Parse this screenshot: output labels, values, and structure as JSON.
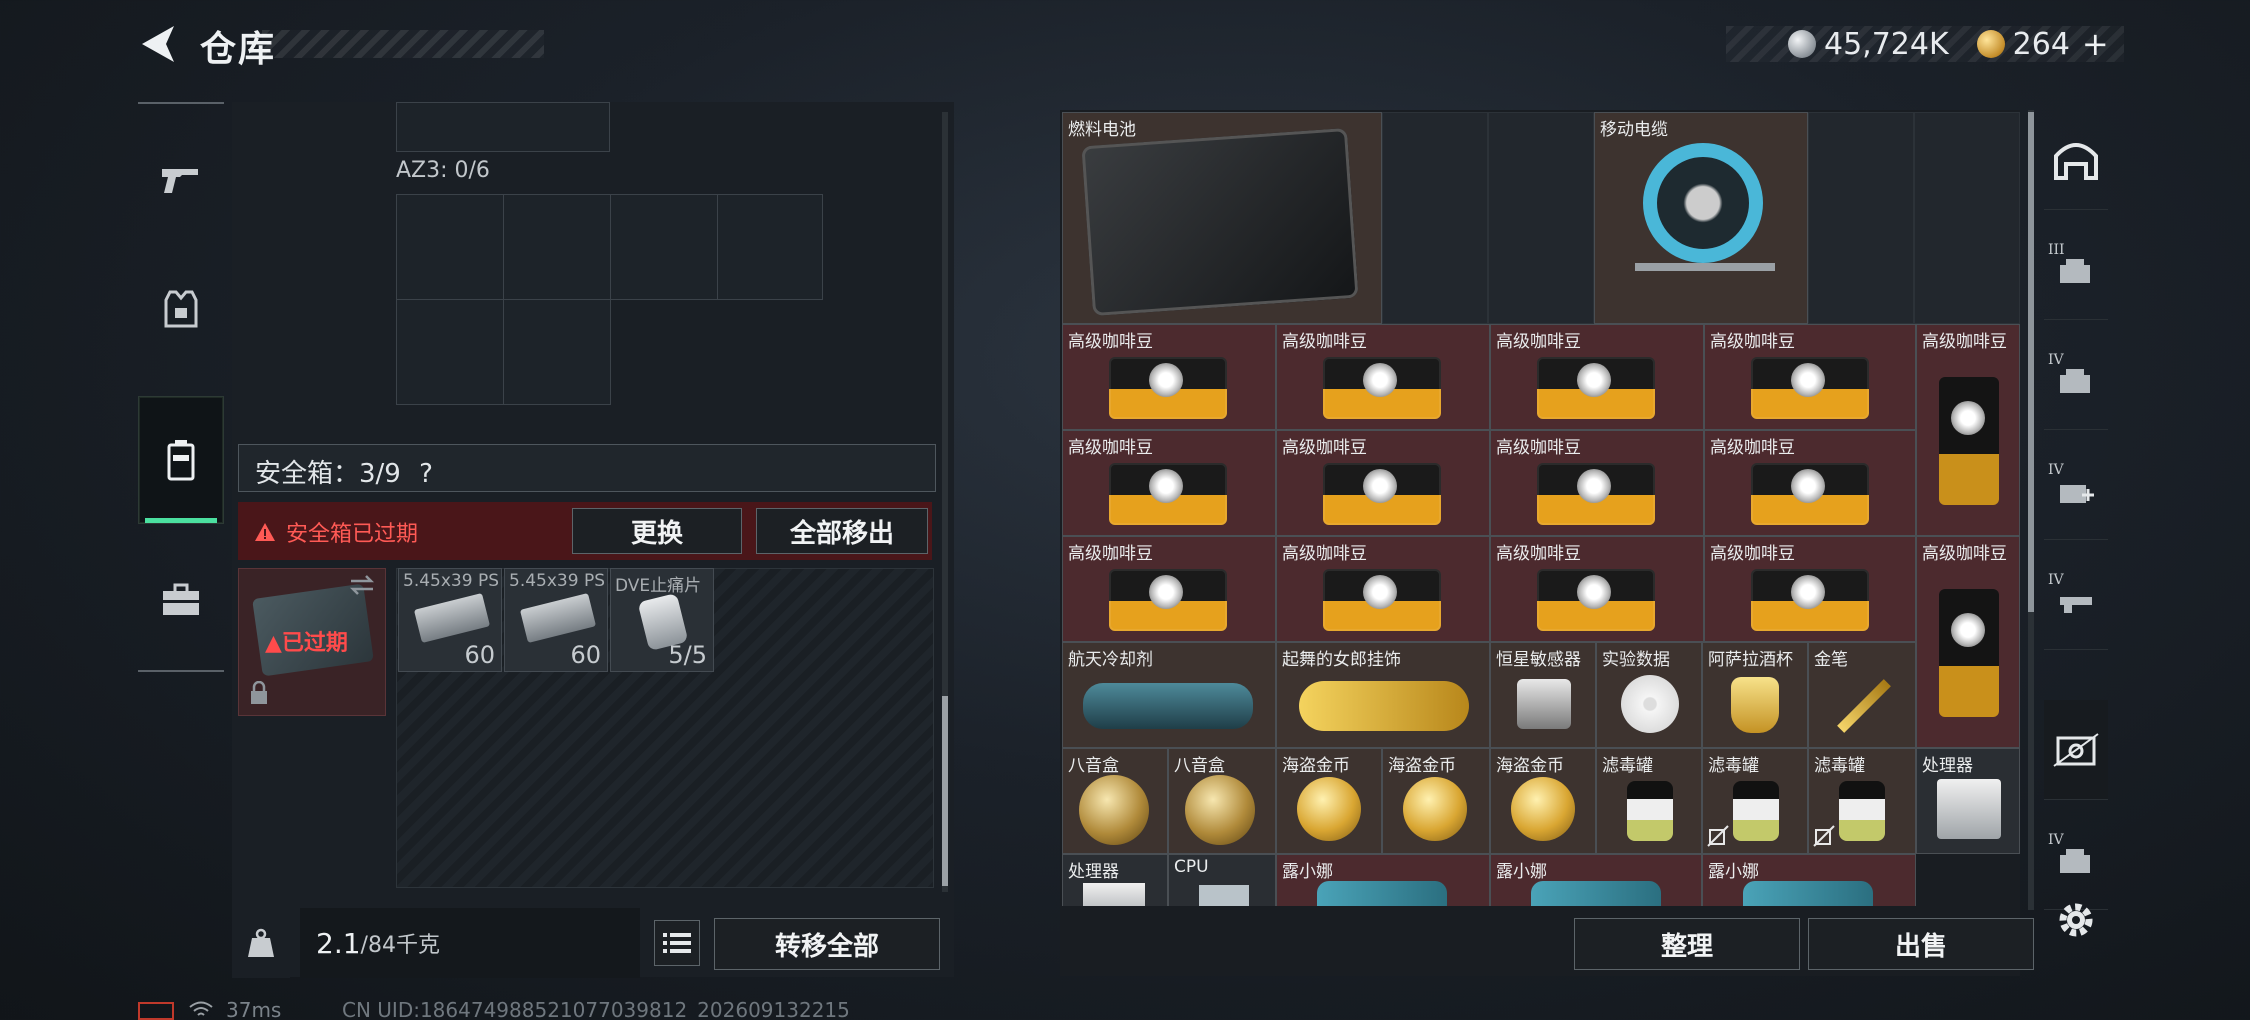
{
  "header": {
    "title": "仓库"
  },
  "currency": {
    "silver": "45,724K",
    "gold": "264",
    "plus": "+"
  },
  "left_nav": {
    "items": [
      {
        "name": "weapons"
      },
      {
        "name": "equipment"
      },
      {
        "name": "containers",
        "active": true
      },
      {
        "name": "toolbox"
      }
    ]
  },
  "left_panel": {
    "az3_label": "AZ3: 0/6",
    "safe_box_label": "安全箱：3/9",
    "safe_box_help": "?",
    "expired_notice": "安全箱已过期",
    "replace_button": "更换",
    "move_all_out_button": "全部移出",
    "secure_box_tag": "已过期",
    "ammo": [
      {
        "name": "5.45x39 PS",
        "count": "60"
      },
      {
        "name": "5.45x39 PS",
        "count": "60"
      },
      {
        "name": "DVE止痛片",
        "count": "5/5"
      }
    ],
    "weight_value": "2.1",
    "weight_capacity": "/84千克",
    "transfer_all_button": "转移全部"
  },
  "inventory": {
    "items": [
      {
        "name": "燃料电池"
      },
      {
        "name": "移动电缆"
      },
      {
        "name": "高级咖啡豆"
      },
      {
        "name": "航天冷却剂"
      },
      {
        "name": "起舞的女郎挂饰"
      },
      {
        "name": "恒星敏感器"
      },
      {
        "name": "实验数据"
      },
      {
        "name": "阿萨拉酒杯"
      },
      {
        "name": "金笔"
      },
      {
        "name": "八音盒"
      },
      {
        "name": "海盗金币"
      },
      {
        "name": "滤毒罐"
      },
      {
        "name": "处理器"
      },
      {
        "name": "CPU"
      },
      {
        "name": "露小娜"
      }
    ],
    "sort_button": "整理",
    "sell_button": "出售"
  },
  "status_bar": {
    "ping": "37ms",
    "uid": "CN UID:18647498852107703981​2_202609132215"
  },
  "right_nav": {
    "labels": [
      "III",
      "IV",
      "IV",
      "IV",
      "IV"
    ]
  }
}
